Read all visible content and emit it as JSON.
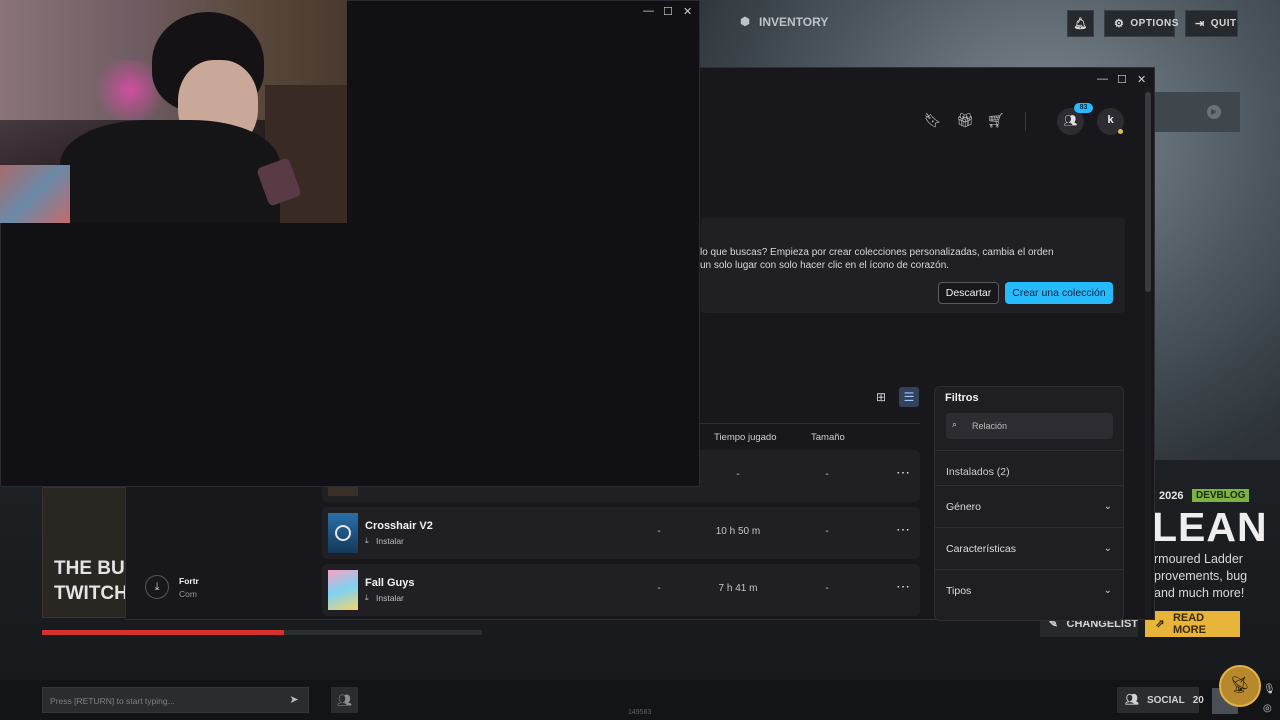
{
  "game_menu": {
    "inventory_label": "INVENTORY",
    "options_label": "OPTIONS",
    "quit_label": "QUIT",
    "news": {
      "year": "2026",
      "badge": "DEVBLOG",
      "headline": "LEAN",
      "lines": [
        "rmoured Ladder",
        "provements, bug",
        "and much more!"
      ],
      "changelist_label": "CHANGELIST",
      "read_more_label": "READ MORE"
    },
    "promo": {
      "line1": "THE BU",
      "line2": "TWITCH"
    },
    "progress": 0.55,
    "chat_placeholder": "Press [RETURN] to start typing...",
    "social_label": "SOCIAL",
    "social_count": "20",
    "footer_number": "149583"
  },
  "epic_launcher": {
    "friends_badge": "83",
    "avatar_initial": "k",
    "banner": {
      "line1": "lo que buscas? Empieza por crear colecciones personalizadas, cambia el orden",
      "line2": "un solo lugar con solo hacer clic en el ícono de corazón.",
      "dismiss_label": "Descartar",
      "create_label": "Crear una colección"
    },
    "columns": {
      "played": "Tiempo jugado",
      "size": "Tamaño"
    },
    "games": [
      {
        "name": "",
        "action": "",
        "col1": "",
        "played": "-",
        "size": "-"
      },
      {
        "name": "Crosshair V2",
        "action": "Instalar",
        "col1": "-",
        "played": "10 h 50 m",
        "size": "-"
      },
      {
        "name": "Fall Guys",
        "action": "Instalar",
        "col1": "-",
        "played": "7 h 41 m",
        "size": "-"
      }
    ],
    "download": {
      "title": "Fortr",
      "subtitle": "Com"
    },
    "filters": {
      "title": "Filtros",
      "search_placeholder": "Relación",
      "installed": "Instalados (2)",
      "genre": "Género",
      "features": "Características",
      "types": "Tipos"
    }
  },
  "colors": {
    "accent": "#26bbff",
    "devblog": "#7cb342",
    "read_more": "#e8b43a",
    "progress": "#d3322f"
  }
}
